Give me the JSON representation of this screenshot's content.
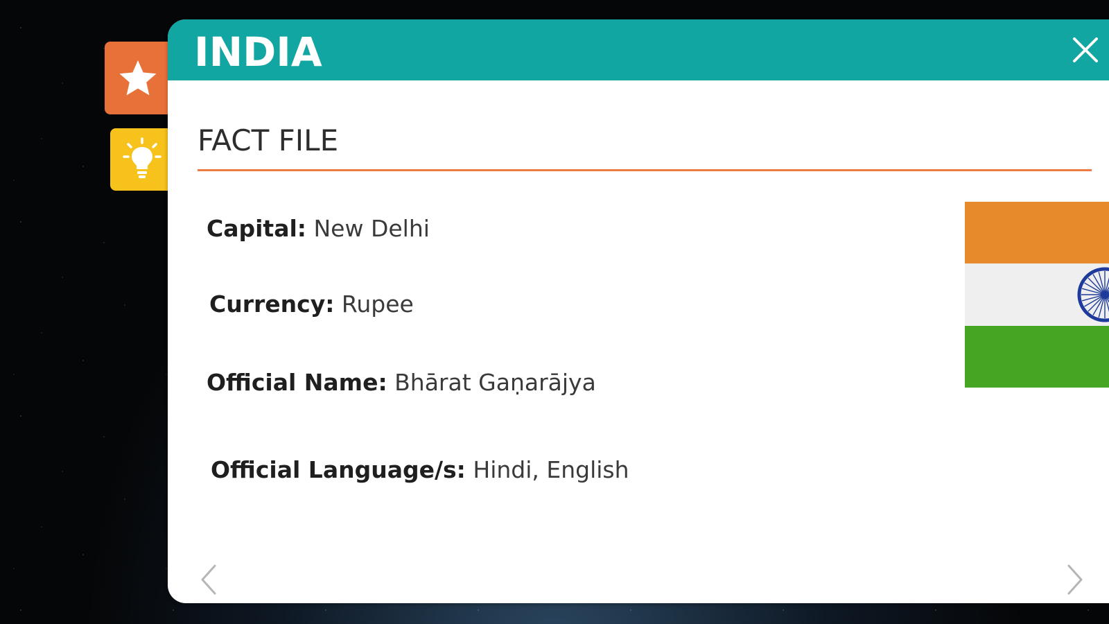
{
  "side_buttons": {
    "favorite_icon": "star-icon",
    "hint_icon": "lightbulb-icon",
    "favorite_color": "#e8713a",
    "hint_color": "#f7c21b"
  },
  "panel": {
    "title": "INDIA",
    "close_icon": "close-icon",
    "header_color": "#12a6a2",
    "section_heading": "FACT FILE",
    "accent_color": "#ee7a44"
  },
  "facts": [
    {
      "label": "Capital:",
      "value": "New Delhi"
    },
    {
      "label": "Currency:",
      "value": "Rupee"
    },
    {
      "label": "Official Name:",
      "value": "Bhārat Gaṇarājya"
    },
    {
      "label": "Official Language/s:",
      "value": "Hindi, English"
    }
  ],
  "flag": {
    "icon": "india-flag",
    "colors": {
      "top": "#e78a2c",
      "middle": "#efefef",
      "bottom": "#46a523",
      "wheel": "#1e3a9a"
    }
  },
  "navigation": {
    "prev_icon": "chevron-left-icon",
    "next_icon": "chevron-right-icon"
  }
}
